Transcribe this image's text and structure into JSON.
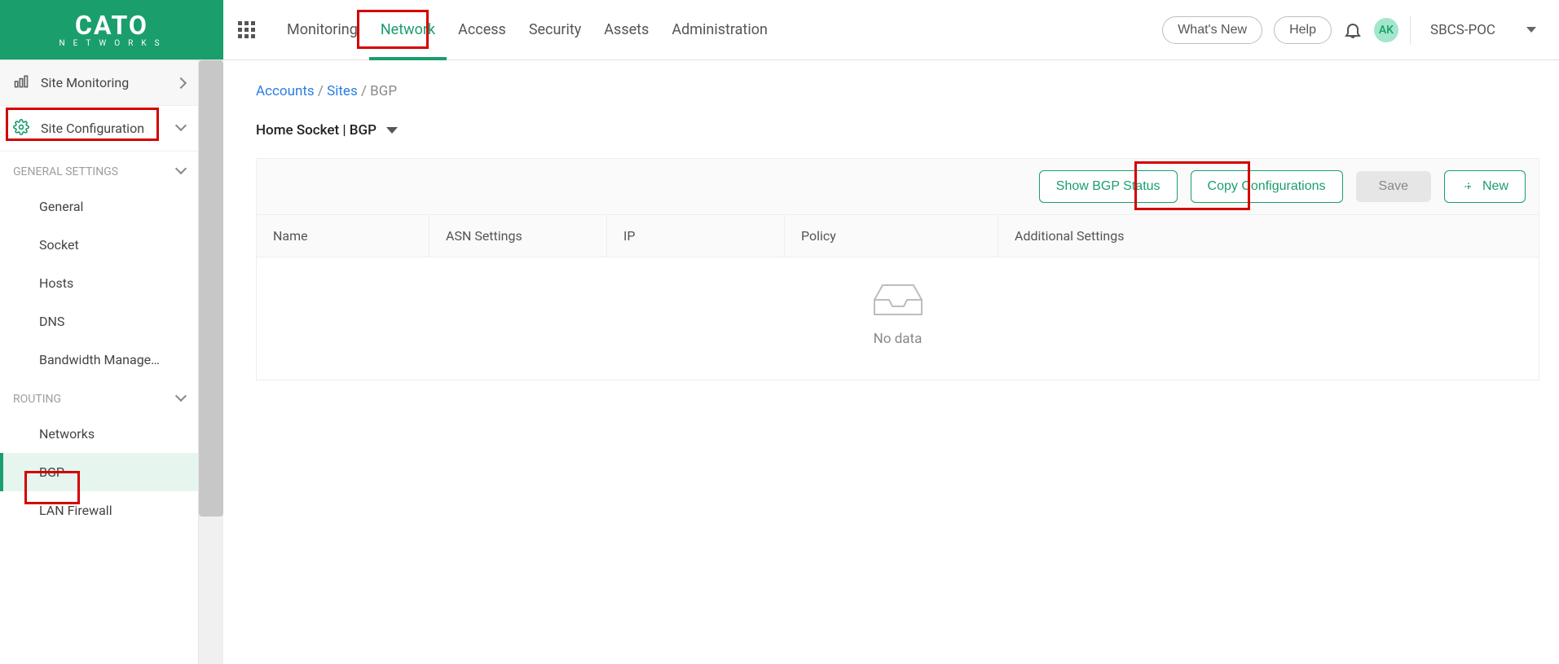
{
  "logo": {
    "brand": "CATO",
    "tagline": "NETWORKS"
  },
  "main_nav": {
    "monitoring": "Monitoring",
    "network": "Network",
    "access": "Access",
    "security": "Security",
    "assets": "Assets",
    "administration": "Administration"
  },
  "header": {
    "whats_new": "What's New",
    "help": "Help",
    "avatar_initials": "AK",
    "account_name": "SBCS-POC"
  },
  "sidebar": {
    "site_monitoring": "Site Monitoring",
    "site_configuration": "Site Configuration",
    "sections": {
      "general_settings": {
        "label": "GENERAL SETTINGS",
        "items": {
          "general": "General",
          "socket": "Socket",
          "hosts": "Hosts",
          "dns": "DNS",
          "bandwidth": "Bandwidth Manage…"
        }
      },
      "routing": {
        "label": "ROUTING",
        "items": {
          "networks": "Networks",
          "bgp": "BGP",
          "lan_firewall": "LAN Firewall"
        }
      }
    }
  },
  "breadcrumb": {
    "accounts": "Accounts",
    "sites": "Sites",
    "current": "BGP"
  },
  "page": {
    "title": "Home Socket | BGP"
  },
  "toolbar": {
    "show_status": "Show BGP Status",
    "copy_config": "Copy Configurations",
    "save": "Save",
    "new": "New"
  },
  "table": {
    "columns": {
      "name": "Name",
      "asn": "ASN Settings",
      "ip": "IP",
      "policy": "Policy",
      "additional": "Additional Settings"
    },
    "empty": "No data"
  }
}
